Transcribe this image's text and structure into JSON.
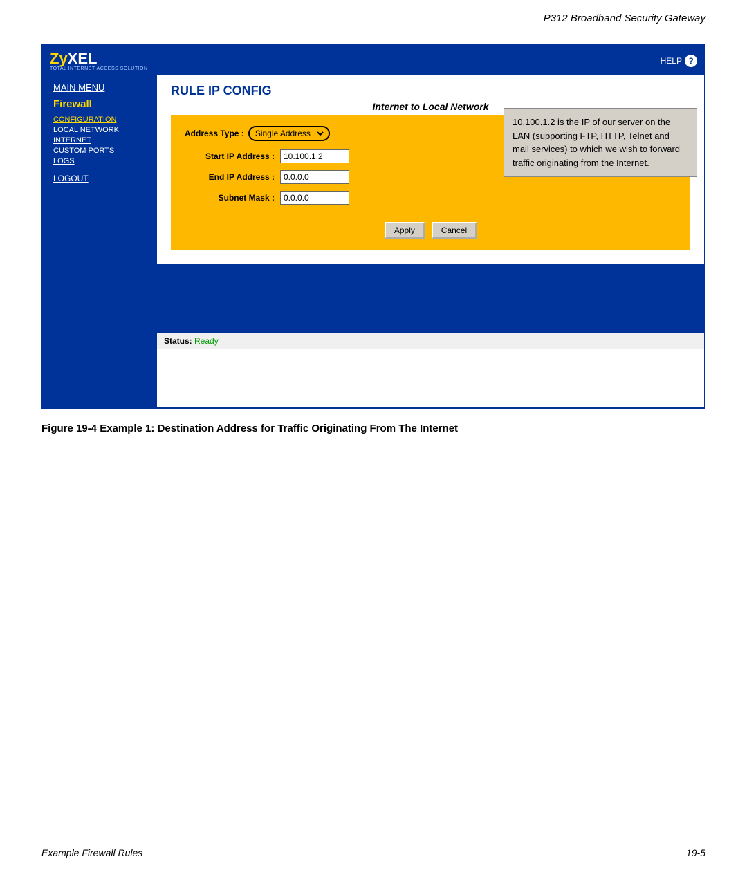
{
  "header": {
    "title": "P312  Broadband Security Gateway"
  },
  "footer": {
    "left": "Example Firewall Rules",
    "right": "19-5"
  },
  "figure": {
    "caption": "Figure 19-4     Example 1: Destination Address for Traffic Originating From The Internet"
  },
  "sidebar": {
    "logo_zy": "Zy",
    "logo_xel": "XEL",
    "logo_sub": "Total Internet Access Solution",
    "main_menu": "MAIN MENU",
    "firewall": "Firewall",
    "nav_items": [
      {
        "label": "CONFIGURATION",
        "active": true
      },
      {
        "label": "LOCAL NETWORK",
        "active": false
      },
      {
        "label": "INTERNET",
        "active": false
      },
      {
        "label": "CUSTOM PORTS",
        "active": false
      },
      {
        "label": "LOGS",
        "active": false
      }
    ],
    "logout": "LOGOUT"
  },
  "help": {
    "label": "HELP",
    "icon": "?"
  },
  "content": {
    "title": "RULE IP CONFIG",
    "subtitle": "Internet to Local Network",
    "address_type_label": "Address Type :",
    "address_type_value": "Single Address",
    "start_ip_label": "Start IP Address :",
    "start_ip_value": "10.100.1.2",
    "end_ip_label": "End IP Address :",
    "end_ip_value": "0.0.0.0",
    "subnet_mask_label": "Subnet Mask :",
    "subnet_mask_value": "0.0.0.0",
    "apply_btn": "Apply",
    "cancel_btn": "Cancel",
    "tooltip": "10.100.1.2 is the IP of our server on the LAN (supporting FTP, HTTP, Telnet and mail services) to which we wish to forward traffic originating from the Internet."
  },
  "status": {
    "label": "Status:",
    "value": "Ready"
  }
}
